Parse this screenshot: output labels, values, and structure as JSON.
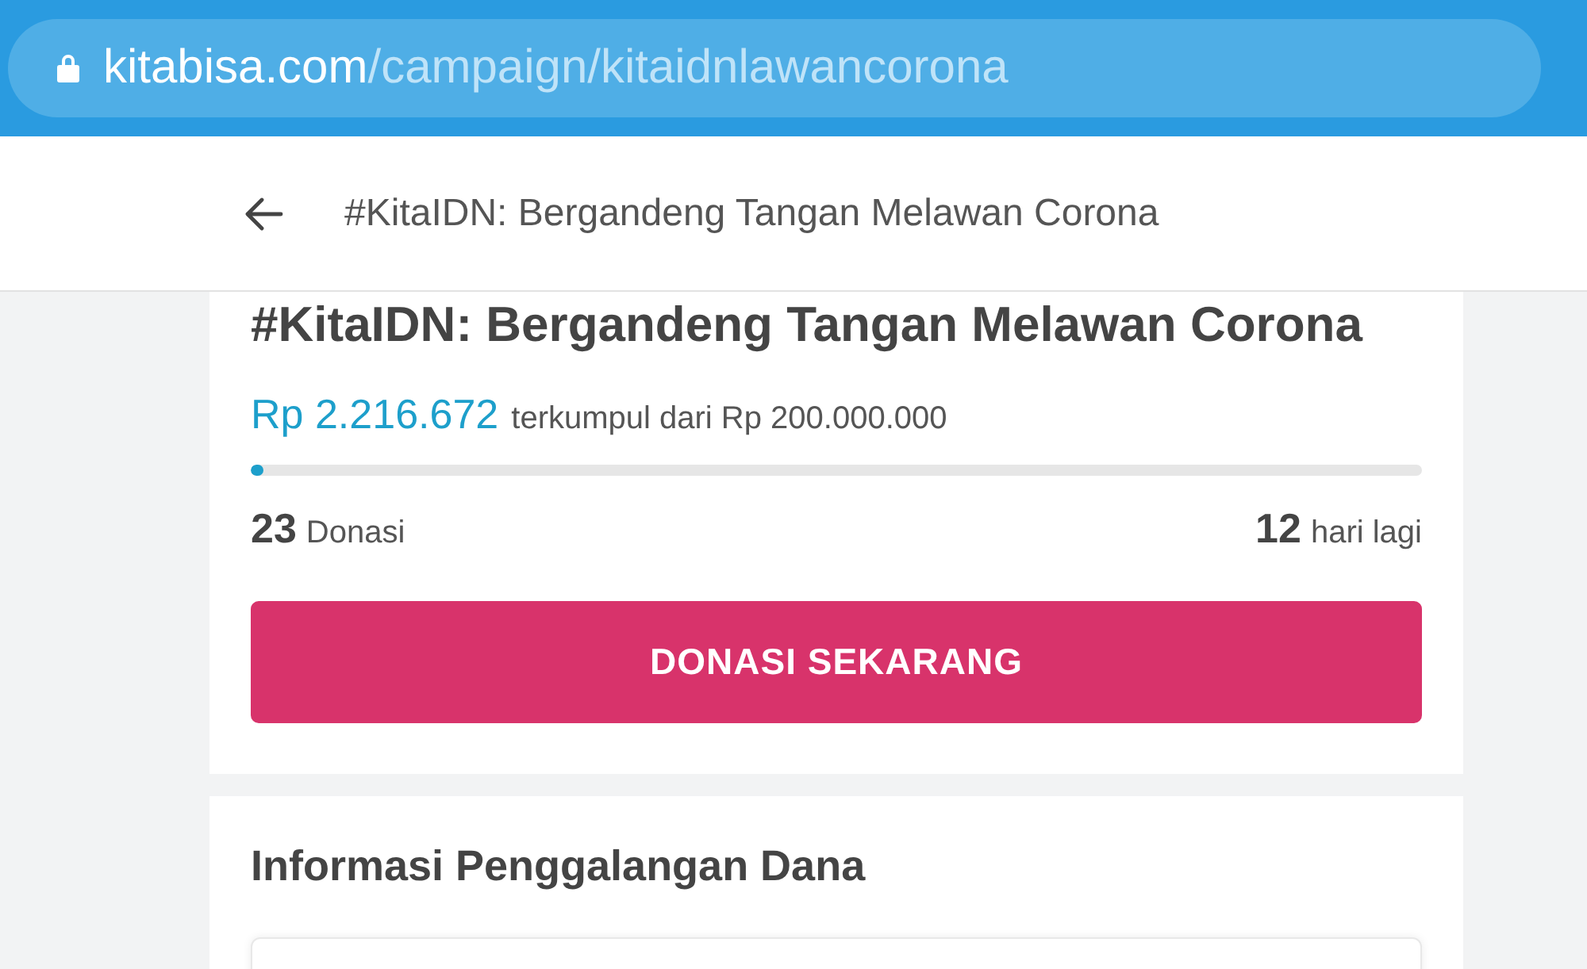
{
  "browser": {
    "url_host": "kitabisa.com",
    "url_path": "/campaign/kitaidnlawancorona"
  },
  "header": {
    "title": "#KitaIDN: Bergandeng Tangan Melawan Corona"
  },
  "campaign": {
    "title": "#KitaIDN: Bergandeng Tangan Melawan Corona",
    "collected": "Rp 2.216.672",
    "target": "terkumpul dari Rp 200.000.000",
    "progress": {
      "level": 0.011
    },
    "donations": {
      "count": "23",
      "label": "Donasi"
    },
    "days_left": {
      "count": "12",
      "label": "hari lagi"
    },
    "button": "DONASI SEKARANG"
  },
  "info": {
    "title": "Informasi Penggalangan Dana"
  }
}
